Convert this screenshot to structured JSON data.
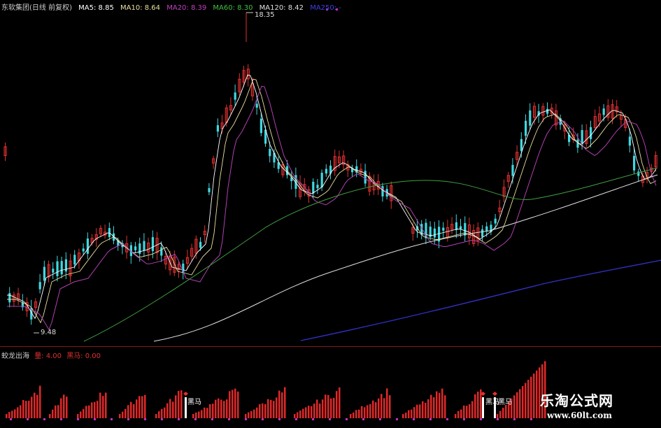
{
  "header": {
    "stock": "东软集团(日线 前复权)",
    "ma5": "MA5: 8.85",
    "ma10": "MA10: 8.64",
    "ma20": "MA20: 8.39",
    "ma60": "MA60: 8.30",
    "ma120": "MA120: 8.42",
    "ma250": "MA250: -"
  },
  "indicator": {
    "name": "蛟龙出海",
    "field1": "量: 4.00",
    "field2": "黑马: 0.00"
  },
  "annotations": {
    "high_price": "18.35",
    "low_price": "9.48",
    "signal_1": "黑马",
    "signal_2": "黑马",
    "signal_3": "黑马"
  },
  "watermark": {
    "title": "乐淘公式网",
    "url": "www.60lt.com"
  },
  "colors": {
    "bull": "#e03030",
    "bear": "#40d8e0",
    "ma5": "#ffffff",
    "ma10": "#e8e0a0",
    "ma20": "#b040b0",
    "ma60": "#40a040",
    "ma120": "#e0e0e0",
    "ma250": "#3030c0"
  }
}
